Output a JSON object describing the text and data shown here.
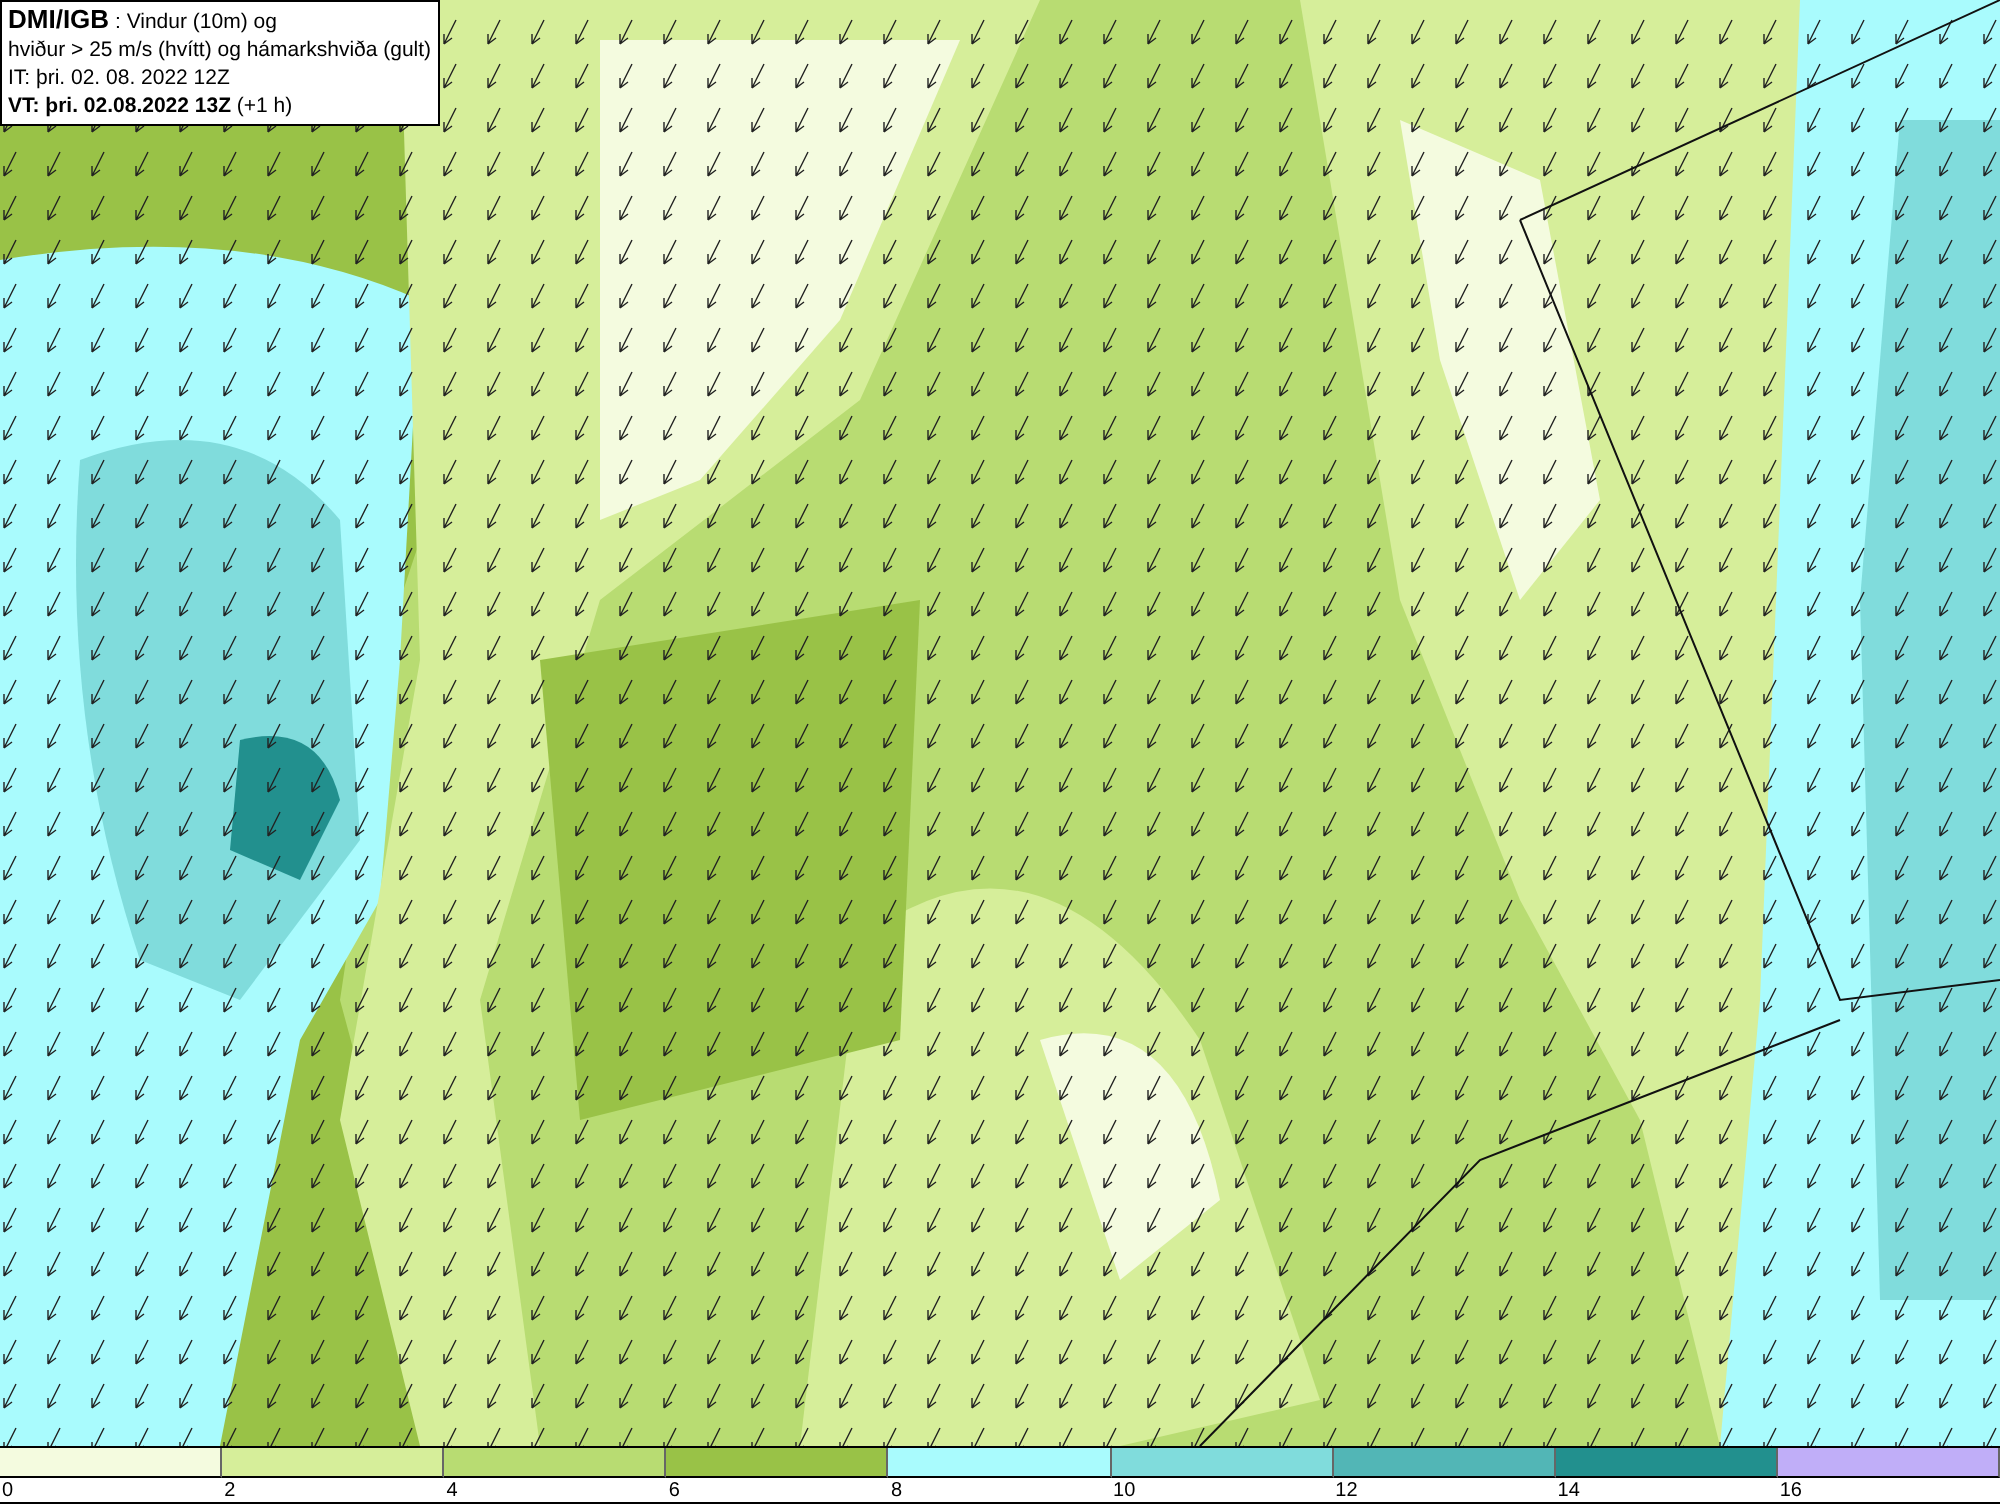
{
  "info_box": {
    "lines": [
      "**DMI/IGB** : Vindur (10m) og",
      "hviður > 25 m/s (hvítt) og hámarkshviða (gult)",
      "IT: þri. 02. 08. 2022 12Z",
      "**VT: þri. 02.08.2022 13Z** (+1 h)"
    ]
  },
  "legend": {
    "bins": [
      {
        "label": "0",
        "color": "#f4fbdf"
      },
      {
        "label": "2",
        "color": "#d6ee9a"
      },
      {
        "label": "4",
        "color": "#b8dc72"
      },
      {
        "label": "6",
        "color": "#99c247"
      },
      {
        "label": "8",
        "color": "#a9fbfd"
      },
      {
        "label": "10",
        "color": "#80dcdc"
      },
      {
        "label": "12",
        "color": "#52b6b6"
      },
      {
        "label": "14",
        "color": "#22908e"
      },
      {
        "label": "16",
        "color": "#c0aef8"
      }
    ]
  }
}
